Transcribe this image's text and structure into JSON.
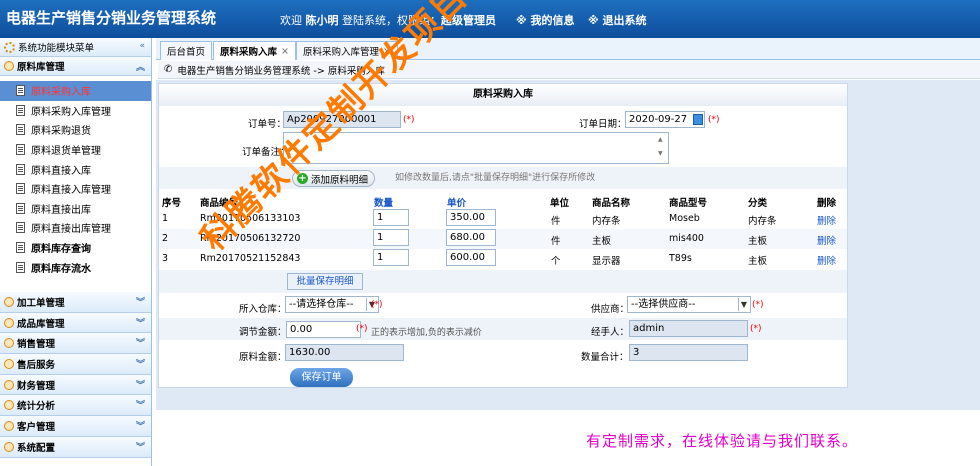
{
  "header": {
    "app_title": "电器生产销售分销业务管理系统",
    "welcome_prefix": "欢迎",
    "user_name": "陈小明",
    "welcome_mid": "登陆系统，权限组：",
    "role": "超级管理员",
    "my_info": "※ 我的信息",
    "logout": "※ 退出系统"
  },
  "sidebar": {
    "menu_title": "系统功能模块菜单",
    "active_group": "原料库管理",
    "items": [
      {
        "label": "原料采购入库",
        "active": true,
        "bold": false
      },
      {
        "label": "原料采购入库管理",
        "active": false,
        "bold": false
      },
      {
        "label": "原料采购退货",
        "active": false,
        "bold": false
      },
      {
        "label": "原料退货单管理",
        "active": false,
        "bold": false
      },
      {
        "label": "原料直接入库",
        "active": false,
        "bold": false
      },
      {
        "label": "原料直接入库管理",
        "active": false,
        "bold": false
      },
      {
        "label": "原料直接出库",
        "active": false,
        "bold": false
      },
      {
        "label": "原料直接出库管理",
        "active": false,
        "bold": false
      },
      {
        "label": "原料库存查询",
        "active": false,
        "bold": true
      },
      {
        "label": "原料库存流水",
        "active": false,
        "bold": true
      }
    ],
    "groups": [
      "加工单管理",
      "成品库管理",
      "销售管理",
      "售后服务",
      "财务管理",
      "统计分析",
      "客户管理",
      "系统配置"
    ]
  },
  "tabs": [
    {
      "label": "后台首页",
      "closable": false
    },
    {
      "label": "原料采购入库",
      "closable": true
    },
    {
      "label": "原料采购入库管理",
      "closable": true
    }
  ],
  "breadcrumb": "电器生产销售分销业务管理系统 -> 原料采购入库",
  "form": {
    "title": "原料采购入库",
    "order_no_label": "订单号：",
    "order_no": "Ap200927000001",
    "order_date_label": "订单日期：",
    "order_date": "2020-09-27",
    "remark_label": "订单备注：",
    "remark": "",
    "add_button": "添加原料明细",
    "hint": "如修改数量后,请点\"批量保存明细\"进行保存所修改",
    "required_mark": "(*)",
    "columns": [
      "序号",
      "商品编号",
      "数量",
      "单价",
      "单位",
      "商品名称",
      "商品型号",
      "分类",
      "删除"
    ],
    "rows": [
      {
        "no": "1",
        "code": "Rm20170506133103",
        "qty": "1",
        "price": "350.00",
        "unit": "件",
        "name": "内存条",
        "model": "Moseb",
        "category": "内存条",
        "delete": "删除"
      },
      {
        "no": "2",
        "code": "Rm20170506132720",
        "qty": "1",
        "price": "680.00",
        "unit": "件",
        "name": "主板",
        "model": "mis400",
        "category": "主板",
        "delete": "删除"
      },
      {
        "no": "3",
        "code": "Rm20170521152843",
        "qty": "1",
        "price": "600.00",
        "unit": "个",
        "name": "显示器",
        "model": "T89s",
        "category": "主板",
        "delete": "删除"
      }
    ],
    "batch_save": "批量保存明细",
    "warehouse_label": "所入仓库：",
    "warehouse_value": "--请选择仓库--",
    "supplier_label": "供应商：",
    "supplier_value": "--选择供应商--",
    "adjust_label": "调节金额：",
    "adjust_value": "0.00",
    "adjust_hint": "正的表示增加,负的表示减价",
    "handler_label": "经手人：",
    "handler_value": "admin",
    "amount_label": "原料金额：",
    "amount_value": "1630.00",
    "qty_total_label": "数量合计：",
    "qty_total_value": "3",
    "save_button": "保存订单"
  },
  "watermark": "科腾软件定制开发项目之一",
  "promo": "有定制需求，在线体验请与我们联系。"
}
